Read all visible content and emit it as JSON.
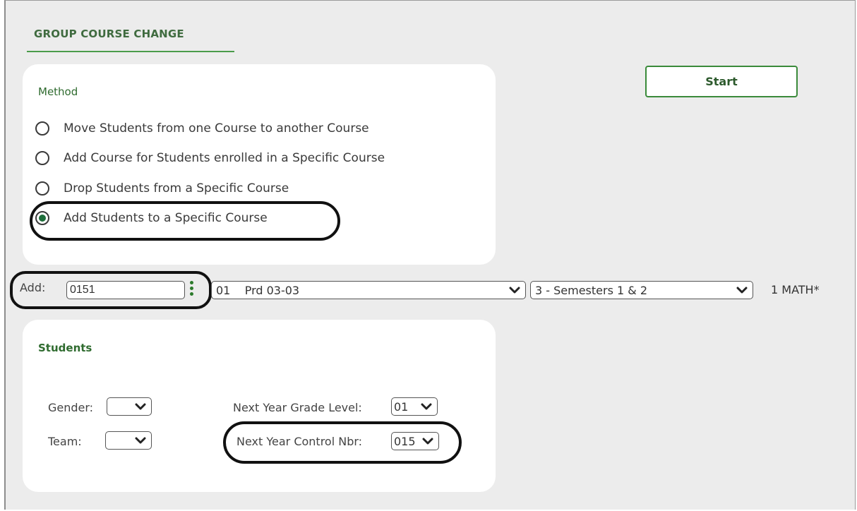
{
  "page": {
    "tab_title": "GROUP COURSE CHANGE"
  },
  "method": {
    "title": "Method",
    "options": [
      {
        "label": "Move Students from one Course to another Course",
        "selected": false
      },
      {
        "label": "Add Course for Students enrolled in a Specific Course",
        "selected": false
      },
      {
        "label": "Drop Students from a Specific Course",
        "selected": false
      },
      {
        "label": "Add Students to a Specific Course",
        "selected": true
      }
    ]
  },
  "start_button": {
    "label": "Start"
  },
  "add_row": {
    "label": "Add:",
    "course_value": "0151",
    "section_select": "01    Prd 03-03",
    "semester_select": "3 - Semesters 1 & 2",
    "course_name": "1 MATH*"
  },
  "students": {
    "title": "Students",
    "gender_label": "Gender:",
    "gender_value": "",
    "team_label": "Team:",
    "team_value": "",
    "grade_label": "Next Year Grade Level:",
    "grade_value": "01",
    "control_label": "Next Year Control Nbr:",
    "control_value": "015"
  },
  "icons": [
    "chevron-down-icon",
    "kebab-menu-icon",
    "radio-icon"
  ],
  "colors": {
    "accent_green": "#3a8a3a",
    "title_green": "#2f6b2f",
    "panel_bg": "#ececec",
    "highlight": "#111111"
  }
}
